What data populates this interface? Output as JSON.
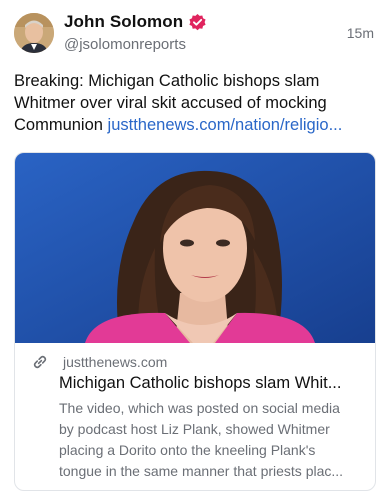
{
  "author": {
    "name": "John Solomon",
    "handle": "@jsolomonreports",
    "verified": true,
    "avatar": "avatar-photo"
  },
  "timestamp": "15m",
  "post": {
    "text": "Breaking: Michigan Catholic bishops slam Whitmer over viral skit accused of mocking Communion ",
    "link": "justthenews.com/nation/religio..."
  },
  "link_card": {
    "image": "news-photo",
    "icon": "link-icon",
    "domain": "justthenews.com",
    "title": "Michigan Catholic bishops slam Whit...",
    "description_lines": [
      "The video, which was posted on social media",
      "by podcast host Liz Plank, showed Whitmer",
      "placing a Dorito onto the kneeling Plank's",
      "tongue in the same manner that priests plac..."
    ]
  },
  "colors": {
    "verified": "#e0245e",
    "link": "#2a67c8",
    "secondary_text": "#6b6f76",
    "card_image_bg": "#1e4fa3"
  }
}
